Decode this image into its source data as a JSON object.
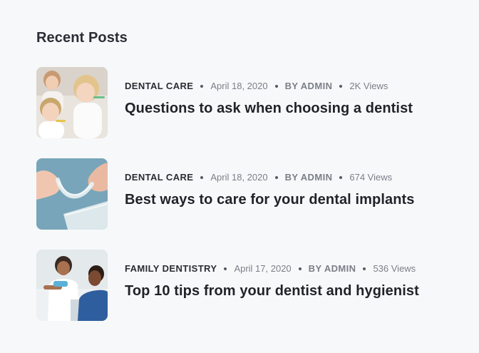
{
  "widget": {
    "title": "Recent Posts"
  },
  "posts": [
    {
      "category": "DENTAL CARE",
      "date": "April 18, 2020",
      "author": "BY ADMIN",
      "views": "2K Views",
      "title": "Questions to ask when choosing a dentist",
      "thumbnail": "family-brushing-teeth-photo"
    },
    {
      "category": "DENTAL CARE",
      "date": "April 18, 2020",
      "author": "BY ADMIN",
      "views": "674 Views",
      "title": "Best ways to care for your dental implants",
      "thumbnail": "clear-aligner-photo"
    },
    {
      "category": "FAMILY DENTISTRY",
      "date": "April 17, 2020",
      "author": "BY ADMIN",
      "views": "536 Views",
      "title": "Top 10 tips from your dentist and hygienist",
      "thumbnail": "dentist-with-patient-photo"
    }
  ],
  "colors": {
    "background": "#f7f8fa",
    "heading": "#1f2328",
    "meta": "#7a7f87"
  }
}
